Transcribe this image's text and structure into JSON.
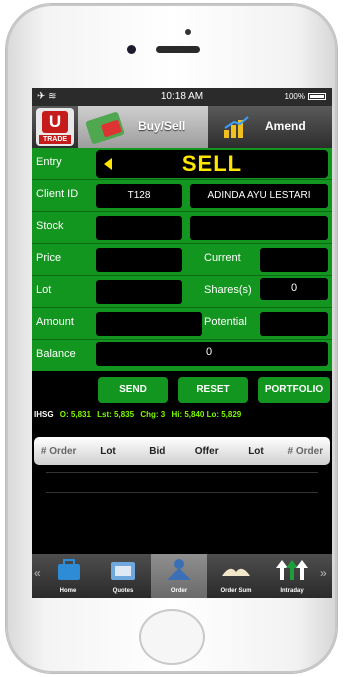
{
  "status": {
    "time": "10:18 AM",
    "battery": "100%"
  },
  "toolbar": {
    "logo_text": "TRADE",
    "logo_letter": "U",
    "buysell_label": "Buy/Sell",
    "amend_label": "Amend"
  },
  "form": {
    "entry_label": "Entry",
    "side": "SELL",
    "client_id_label": "Client ID",
    "client_id": "T128",
    "client_name": "ADINDA AYU LESTARI",
    "stock_label": "Stock",
    "stock_value": "",
    "price_label": "Price",
    "price_value": "",
    "current_label": "Current",
    "current_value": "",
    "lot_label": "Lot",
    "lot_value": "",
    "shares_label": "Shares(s)",
    "shares_value": "0",
    "amount_label": "Amount",
    "amount_value": "",
    "potential_label": "Potential",
    "potential_value": "",
    "balance_label": "Balance",
    "balance_value": "0"
  },
  "actions": {
    "send": "SEND",
    "reset": "RESET",
    "portfolio": "PORTFOLIO"
  },
  "ticker": {
    "index": "IHSG",
    "open": "O: 5,831",
    "last": "Lst: 5,835",
    "change": "Chg: 3",
    "high_low": "Hi: 5,840 Lo: 5,829"
  },
  "table": {
    "columns": [
      "# Order",
      "Lot",
      "Bid",
      "Offer",
      "Lot",
      "# Order"
    ]
  },
  "navbar": {
    "items": [
      {
        "label": "Home",
        "icon": "briefcase-icon"
      },
      {
        "label": "Quotes",
        "icon": "quotes-icon"
      },
      {
        "label": "Order",
        "icon": "order-icon"
      },
      {
        "label": "Order Sum",
        "icon": "book-icon"
      },
      {
        "label": "Intraday",
        "icon": "arrows-up-icon"
      }
    ],
    "active": "Order"
  },
  "colors": {
    "green": "#13961f",
    "sell_yellow": "#ffe600",
    "ticker_green": "#7cfc00"
  }
}
